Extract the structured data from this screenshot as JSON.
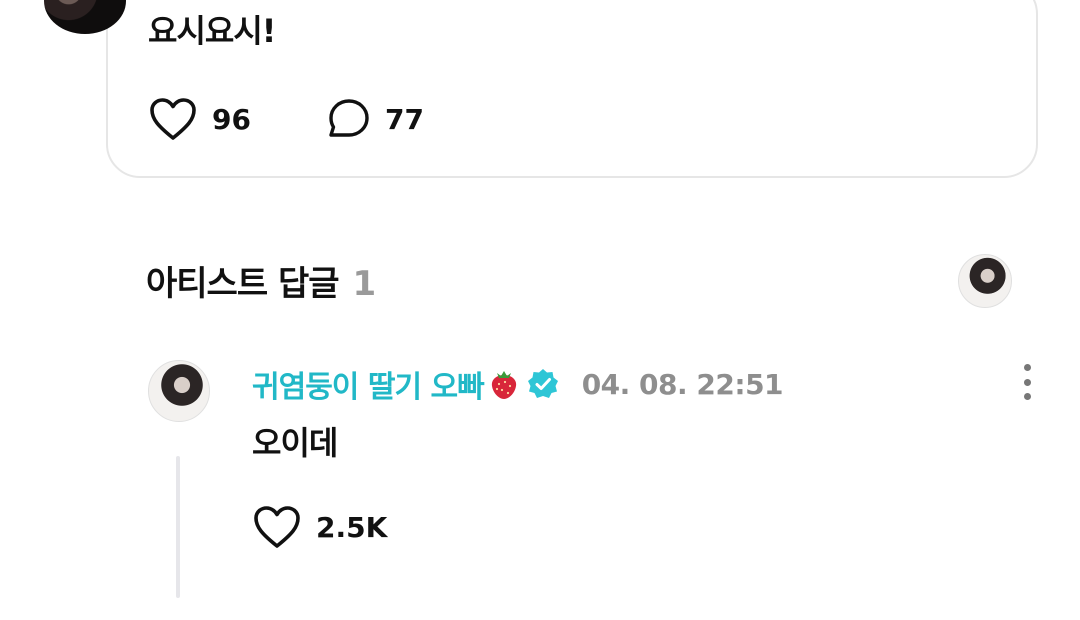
{
  "post": {
    "text": "요시요시!",
    "likes": "96",
    "comments": "77"
  },
  "section": {
    "title": "아티스트 답글",
    "count": "1"
  },
  "reply": {
    "author": "귀염둥이 딸기 오빠",
    "timestamp": "04. 08. 22:51",
    "text": "오이데",
    "likes": "2.5K"
  },
  "icons": {
    "like": "heart-icon",
    "comment": "comment-bubble-icon",
    "verified": "verified-badge-icon",
    "emoji": "strawberry-icon",
    "more": "more-vertical-icon"
  },
  "colors": {
    "author_name": "#21b8c7",
    "verified_badge": "#2ec6d6",
    "meta_gray": "#8e8e8e",
    "card_border": "#e6e6e6"
  }
}
